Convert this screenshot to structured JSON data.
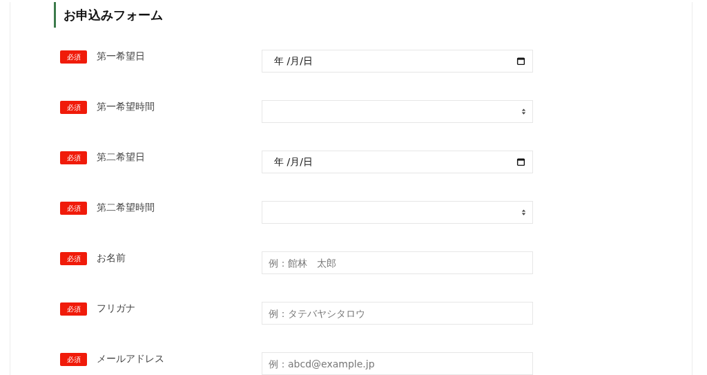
{
  "heading": "お申込みフォーム",
  "fields": [
    {
      "badge": "必須",
      "label": "第一希望日",
      "kind": "date",
      "text": "年 /月/日"
    },
    {
      "badge": "必須",
      "label": "第一希望時間",
      "kind": "select"
    },
    {
      "badge": "必須",
      "label": "第二希望日",
      "kind": "date",
      "text": "年 /月/日"
    },
    {
      "badge": "必須",
      "label": "第二希望時間",
      "kind": "select"
    },
    {
      "badge": "必須",
      "label": "お名前",
      "kind": "text",
      "placeholder": "例：館林　太郎"
    },
    {
      "badge": "必須",
      "label": "フリガナ",
      "kind": "text",
      "placeholder": "例：タテバヤシタロウ"
    },
    {
      "badge": "必須",
      "label": "メールアドレス",
      "kind": "text",
      "placeholder": "例：abcd@example.jp"
    }
  ]
}
